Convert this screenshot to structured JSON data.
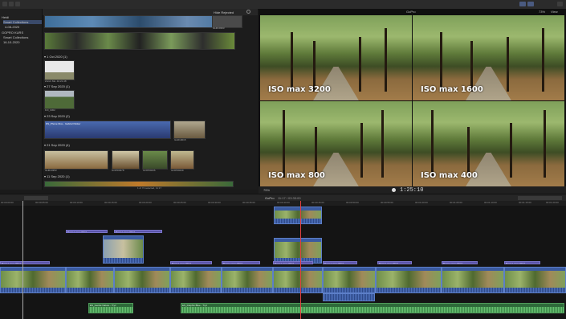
{
  "toolbar": {
    "search_placeholder": "",
    "hide_rejected": "Hide Rejected",
    "viewer_name": "GoPro",
    "zoom": "73%",
    "view": "View"
  },
  "sidebar": {
    "items": [
      {
        "label": "Heidi"
      },
      {
        "label": "Smart Collections"
      },
      {
        "label": "4-08-2020"
      },
      {
        "label": "GOPRO KURS"
      },
      {
        "label": "Smart Collections"
      },
      {
        "label": "16-10-2020"
      }
    ]
  },
  "browser": {
    "groups": [
      {
        "date": "1 Oct 2020",
        "count": "(1)"
      },
      {
        "date": "27 Sep 2020",
        "count": "(1)"
      },
      {
        "date": "23 Sep 2020",
        "count": "(2)"
      },
      {
        "date": "21 Sep 2020",
        "count": "(4)"
      },
      {
        "date": "11 Sep 2020",
        "count": "(1)"
      }
    ],
    "captions": [
      "GH010393",
      "ZoCd..Mo..10.21.48",
      "DJI_0302",
      "DS_Phone Dive - Gabriel Parker",
      "GH010015",
      "GH010353",
      "GOPR0378",
      "GOPR0236",
      "GOPR0239"
    ],
    "status": "1 of 74 selected, 11:17"
  },
  "viewer": {
    "labels": [
      "ISO max 3200",
      "ISO max 1600",
      "ISO max 800",
      "ISO max 400"
    ],
    "timecode": "1:25:10",
    "zoom_menu": "75%"
  },
  "timeline": {
    "project": "GoPro",
    "duration": "11:17 / 03:33:00",
    "ruler": [
      "00:00:00:00",
      "00:00:05:00",
      "00:00:10:00",
      "00:00:15:00",
      "00:00:20:00",
      "00:00:25:00",
      "00:00:30:00",
      "00:00:35:00",
      "00:00:40:00",
      "00:00:45:00",
      "00:00:50:00",
      "00:00:55:00",
      "00:01:00:00",
      "00:01:05:00",
      "00:01:10:00",
      "00:01:15:00",
      "00:01:20:00"
    ],
    "title_clips": [
      "Basic Lower Third",
      "Basic Lower Third",
      "Basic Lower Third",
      "Basic Lower Third",
      "Basic Lower Third",
      "Basic Lower Third",
      "Basic Lower Third",
      "Basic Lower Third",
      "Basic Lower Third",
      "Basic Lower Third"
    ],
    "audio_clips": [
      "ES_Gentle Nature - Tryz",
      "ES_Dolphin Blue - Tryz"
    ]
  }
}
